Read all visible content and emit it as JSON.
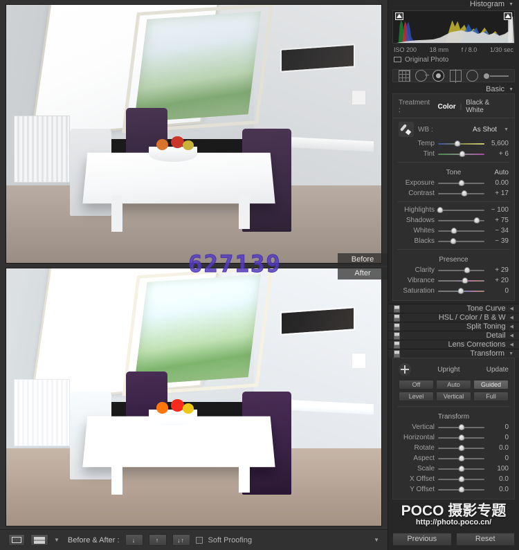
{
  "histogram": {
    "title": "Histogram",
    "exif": {
      "iso": "ISO 200",
      "focal": "18 mm",
      "aperture": "f / 8.0",
      "shutter": "1/30 sec"
    },
    "original_photo_label": "Original Photo"
  },
  "tools": [
    {
      "name": "crop-overlay-tool",
      "icon": "crop-icon"
    },
    {
      "name": "spot-removal-tool",
      "icon": "spot-removal-icon"
    },
    {
      "name": "red-eye-tool",
      "icon": "red-eye-icon"
    },
    {
      "name": "graduated-filter-tool",
      "icon": "graduated-filter-icon"
    },
    {
      "name": "radial-filter-tool",
      "icon": "radial-filter-icon"
    },
    {
      "name": "adjustment-brush-tool",
      "icon": "brush-slider-icon"
    }
  ],
  "basic": {
    "title": "Basic",
    "treatment_label": "Treatment :",
    "treatment_color": "Color",
    "treatment_bw": "Black & White",
    "wb_label": "WB :",
    "wb_value": "As Shot",
    "wb_sliders": [
      {
        "name": "Temp",
        "value": "5,600",
        "pos": 42
      },
      {
        "name": "Tint",
        "value": "+ 6",
        "pos": 52
      }
    ],
    "tone_title": "Tone",
    "auto_label": "Auto",
    "tone_sliders": [
      {
        "name": "Exposure",
        "value": "0.00",
        "pos": 50
      },
      {
        "name": "Contrast",
        "value": "+ 17",
        "pos": 57
      },
      {
        "name": "Highlights",
        "value": "− 100",
        "pos": 4
      },
      {
        "name": "Shadows",
        "value": "+ 75",
        "pos": 84
      },
      {
        "name": "Whites",
        "value": "− 34",
        "pos": 34
      },
      {
        "name": "Blacks",
        "value": "− 39",
        "pos": 33
      }
    ],
    "presence_title": "Presence",
    "presence_sliders": [
      {
        "name": "Clarity",
        "value": "+ 29",
        "pos": 62,
        "track": ""
      },
      {
        "name": "Vibrance",
        "value": "+ 20",
        "pos": 58,
        "track": "vib"
      },
      {
        "name": "Saturation",
        "value": "0",
        "pos": 49,
        "track": "sat"
      }
    ]
  },
  "panels": [
    {
      "title": "Tone Curve",
      "name": "panel-tone-curve"
    },
    {
      "title": "HSL / Color / B & W",
      "name": "panel-hsl-color-bw"
    },
    {
      "title": "Split Toning",
      "name": "panel-split-toning"
    },
    {
      "title": "Detail",
      "name": "panel-detail"
    },
    {
      "title": "Lens Corrections",
      "name": "panel-lens-corrections"
    }
  ],
  "transform": {
    "title": "Transform",
    "upright_label": "Upright",
    "update_label": "Update",
    "upright_buttons": [
      "Off",
      "Auto",
      "Guided",
      "Level",
      "Vertical",
      "Full"
    ],
    "upright_active": "Guided",
    "transform_title": "Transform",
    "sliders": [
      {
        "name": "Vertical",
        "value": "0",
        "pos": 50
      },
      {
        "name": "Horizontal",
        "value": "0",
        "pos": 50
      },
      {
        "name": "Rotate",
        "value": "0.0",
        "pos": 50
      },
      {
        "name": "Aspect",
        "value": "0",
        "pos": 50
      },
      {
        "name": "Scale",
        "value": "100",
        "pos": 50
      },
      {
        "name": "X Offset",
        "value": "0.0",
        "pos": 50
      },
      {
        "name": "Y Offset",
        "value": "0.0",
        "pos": 50
      }
    ]
  },
  "watermark": {
    "main": "POCO 摄影专题",
    "sub": "http://photo.poco.cn/"
  },
  "footer": {
    "previous": "Previous",
    "reset": "Reset"
  },
  "toolbar": {
    "before_after_label": "Before & After :",
    "copy_before_to_after": "↓",
    "copy_after_to_before": "↑",
    "swap_before_after": "↓↑",
    "soft_proofing": "Soft Proofing"
  },
  "image_overlay": {
    "number": "627139",
    "before_label": "Before",
    "after_label": "After"
  },
  "colors": {
    "accent": "#563cbe",
    "panel_bg": "#272727",
    "stage_bg": "#323232"
  }
}
